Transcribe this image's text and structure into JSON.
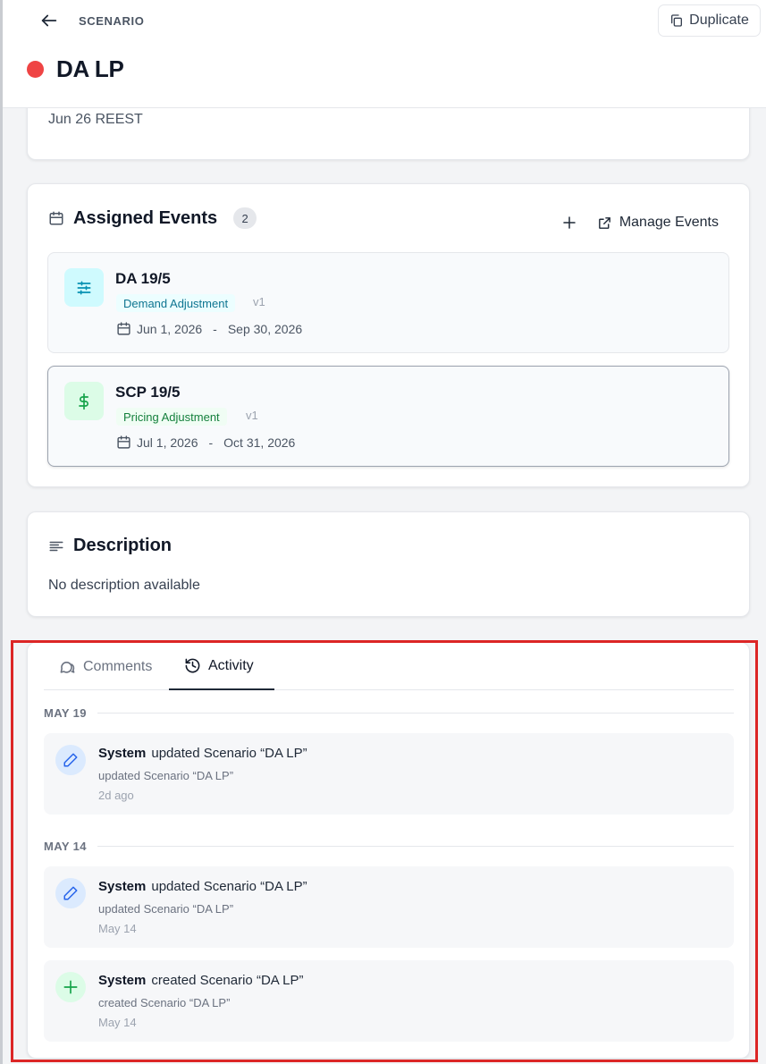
{
  "header": {
    "breadcrumb": "SCENARIO",
    "duplicate_label": "Duplicate",
    "title": "DA LP",
    "status_color": "#ef4444"
  },
  "summary": {
    "date_text": "Jun 26 REEST"
  },
  "assigned_events": {
    "title": "Assigned Events",
    "count": "2",
    "manage_label": "Manage Events",
    "events": [
      {
        "name": "DA 19/5",
        "tag": "Demand Adjustment",
        "version": "v1",
        "start": "Jun 1, 2026",
        "separator": "-",
        "end": "Sep 30, 2026",
        "icon": "sliders-icon",
        "icon_bg": "#cffafe",
        "icon_color": "#0891b2",
        "tag_bg": "#ecfeff",
        "tag_color": "#0e7490"
      },
      {
        "name": "SCP 19/5",
        "tag": "Pricing Adjustment",
        "version": "v1",
        "start": "Jul 1, 2026",
        "separator": "-",
        "end": "Oct 31, 2026",
        "icon": "dollar-icon",
        "icon_bg": "#dcfce7",
        "icon_color": "#16a34a",
        "tag_bg": "#f0fdf4",
        "tag_color": "#15803d"
      }
    ]
  },
  "description": {
    "title": "Description",
    "text": "No description available"
  },
  "activity_panel": {
    "tabs": [
      {
        "label": "Comments",
        "active": false
      },
      {
        "label": "Activity",
        "active": true
      }
    ],
    "groups": [
      {
        "label": "MAY 19",
        "items": [
          {
            "actor": "System",
            "action": "updated Scenario “DA LP”",
            "detail": "updated Scenario “DA LP”",
            "time": "2d ago",
            "icon": "pencil-icon"
          }
        ]
      },
      {
        "label": "MAY 14",
        "items": [
          {
            "actor": "System",
            "action": "updated Scenario “DA LP”",
            "detail": "updated Scenario “DA LP”",
            "time": "May 14",
            "icon": "pencil-icon"
          },
          {
            "actor": "System",
            "action": "created Scenario “DA LP”",
            "detail": "created Scenario “DA LP”",
            "time": "May 14",
            "icon": "plus-icon"
          }
        ]
      }
    ]
  },
  "colors": {
    "accent_dark": "#1f2937",
    "edit_icon_bg": "#dbeafe",
    "edit_icon_color": "#2563eb",
    "create_icon_bg": "#dcfce7",
    "create_icon_color": "#16a34a",
    "highlight": "#dc2626"
  }
}
